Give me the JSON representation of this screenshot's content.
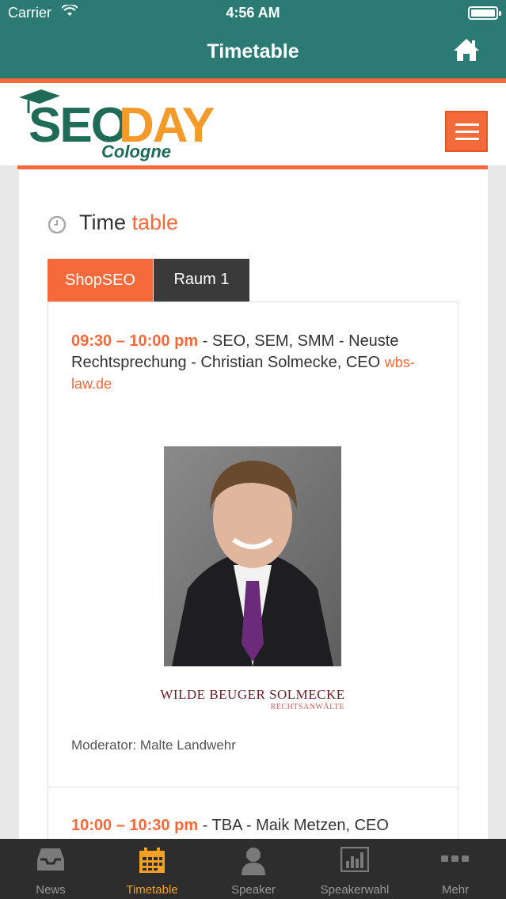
{
  "status_bar": {
    "carrier": "Carrier",
    "time": "4:56 AM"
  },
  "nav": {
    "title": "Timetable",
    "home_icon": "home-icon"
  },
  "header": {
    "logo_main": "SEODAY",
    "logo_sub": "Cologne",
    "menu_icon": "hamburger-icon"
  },
  "section": {
    "title_part1": "Time",
    "title_part2": "table",
    "icon": "clock-icon"
  },
  "tabs": [
    {
      "label": "ShopSEO",
      "active": true
    },
    {
      "label": "Raum 1",
      "active": false
    }
  ],
  "entries": [
    {
      "time": "09:30 – 10:00 pm",
      "text": " - SEO, SEM, SMM - Neuste Rechtsprechung - Christian Solmecke, CEO ",
      "link": "wbs-law.de",
      "firm_logo_line1": "WILDE BEUGER SOLMECKE",
      "firm_logo_line2": "RECHTSANWÄLTE",
      "moderator": "Moderator: Malte Landwehr"
    },
    {
      "time": "10:00 – 10:30 pm",
      "text": " - TBA - Maik Metzen, CEO"
    }
  ],
  "tabbar": [
    {
      "label": "News",
      "icon": "inbox-icon",
      "active": false
    },
    {
      "label": "Timetable",
      "icon": "calendar-icon",
      "active": true
    },
    {
      "label": "Speaker",
      "icon": "person-icon",
      "active": false
    },
    {
      "label": "Speakerwahl",
      "icon": "bar-chart-icon",
      "active": false
    },
    {
      "label": "Mehr",
      "icon": "more-icon",
      "active": false
    }
  ],
  "colors": {
    "teal": "#2b7a73",
    "orange": "#f46a3a",
    "tab_active": "#f4a020"
  }
}
